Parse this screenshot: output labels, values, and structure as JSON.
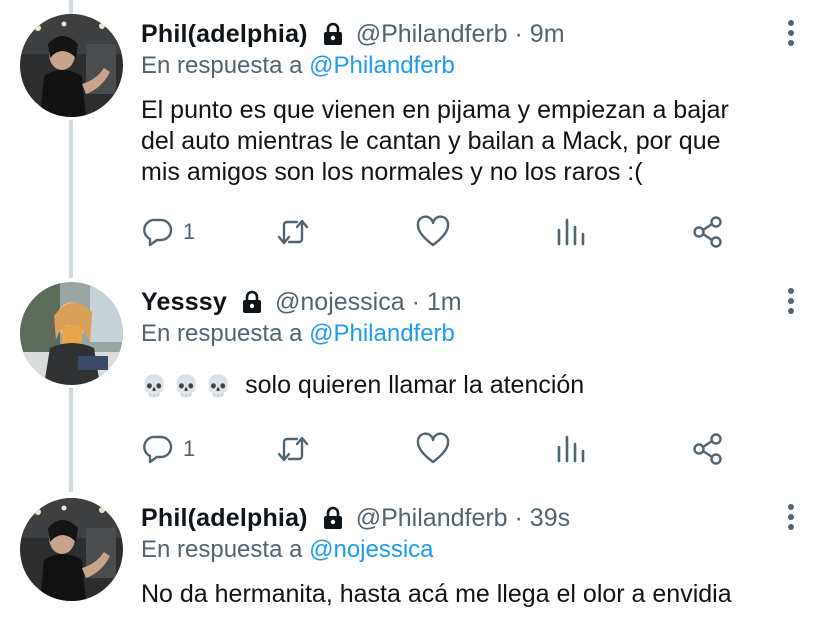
{
  "tweets": [
    {
      "name": "Phil(adelphia)",
      "meta": "@Philandferb · 9m",
      "reply_prefix": "En respuesta a ",
      "reply_handle": "@Philandferb",
      "text_lines": [
        "El punto es que vienen en pijama y empiezan a bajar",
        "del auto mientras le cantan y bailan a Mack, por que",
        "mis amigos son los normales y no los raros :("
      ],
      "reply_count": "1"
    },
    {
      "name": "Yesssy",
      "meta": "@nojessica · 1m",
      "reply_prefix": "En respuesta a ",
      "reply_handle": "@Philandferb",
      "emoji": "💀 💀 💀",
      "text_lines": [
        "solo quieren llamar la atención"
      ],
      "reply_count": "1"
    },
    {
      "name": "Phil(adelphia)",
      "meta": "@Philandferb · 39s",
      "reply_prefix": "En respuesta a ",
      "reply_handle": "@nojessica",
      "text_lines": [
        "No da hermanita, hasta acá me llega el olor a envidia"
      ]
    }
  ],
  "colors": {
    "link": "#1d9bf0",
    "muted": "#536471",
    "text": "#0f1419",
    "thread_line": "#cfd9de"
  },
  "icons": [
    "reply-icon",
    "retweet-icon",
    "like-icon",
    "analytics-icon",
    "share-icon",
    "lock-icon",
    "more-icon"
  ]
}
